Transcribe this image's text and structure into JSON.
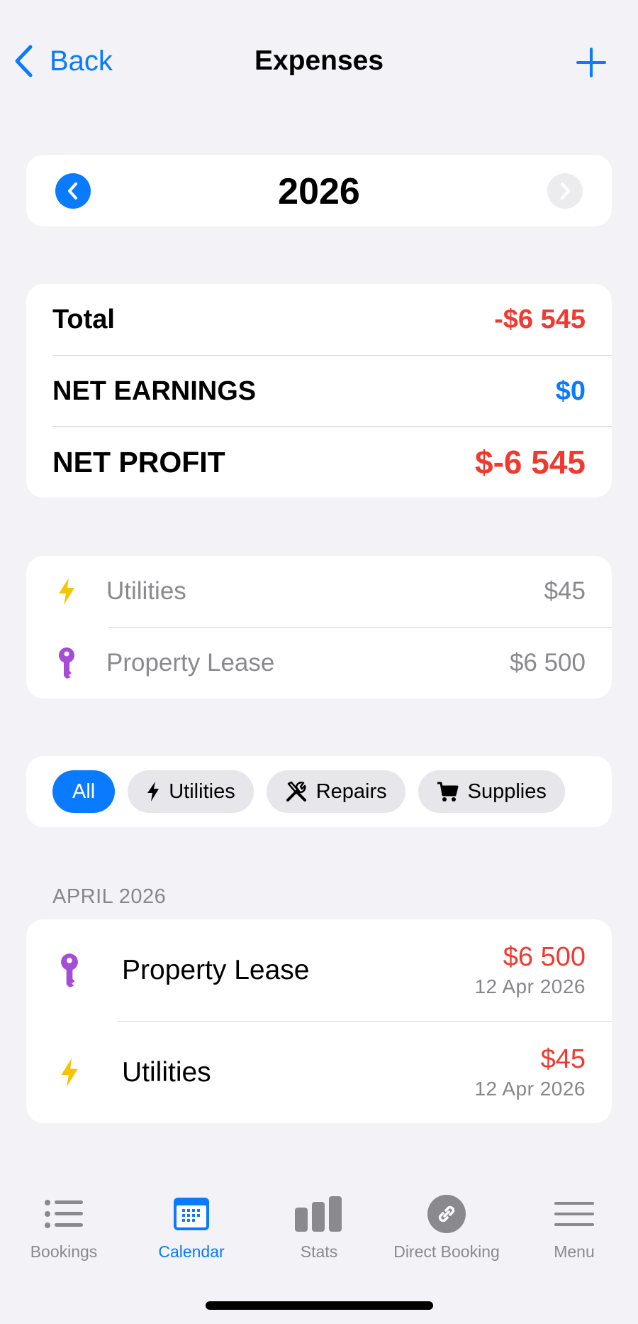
{
  "nav": {
    "back_label": "Back",
    "title": "Expenses"
  },
  "year_selector": {
    "year": "2026"
  },
  "summary": {
    "total_label": "Total",
    "total_value": "-$6 545",
    "net_earnings_label": "NET EARNINGS",
    "net_earnings_value": "$0",
    "net_profit_label": "NET PROFIT",
    "net_profit_value": "$-6 545",
    "colors": {
      "negative": "#f03a30",
      "positive": "#0a7aff"
    }
  },
  "categories": [
    {
      "icon": "bolt-icon",
      "name": "Utilities",
      "amount": "$45",
      "color": "#f5c400"
    },
    {
      "icon": "key-icon",
      "name": "Property Lease",
      "amount": "$6 500",
      "color": "#a64dd6"
    }
  ],
  "filters": [
    {
      "label": "All",
      "active": true
    },
    {
      "label": "Utilities",
      "icon": "bolt-icon"
    },
    {
      "label": "Repairs",
      "icon": "wrench-screwdriver-icon"
    },
    {
      "label": "Supplies",
      "icon": "cart-icon"
    }
  ],
  "list": {
    "section_title": "APRIL 2026",
    "items": [
      {
        "icon": "key-icon",
        "name": "Property Lease",
        "amount": "$6 500",
        "date": "12 Apr 2026"
      },
      {
        "icon": "bolt-icon",
        "name": "Utilities",
        "amount": "$45",
        "date": "12 Apr 2026"
      }
    ]
  },
  "tabbar": [
    {
      "label": "Bookings",
      "icon": "list-icon"
    },
    {
      "label": "Calendar",
      "icon": "calendar-icon",
      "active": true
    },
    {
      "label": "Stats",
      "icon": "bar-chart-icon"
    },
    {
      "label": "Direct Booking",
      "icon": "link-icon"
    },
    {
      "label": "Menu",
      "icon": "menu-icon"
    }
  ]
}
